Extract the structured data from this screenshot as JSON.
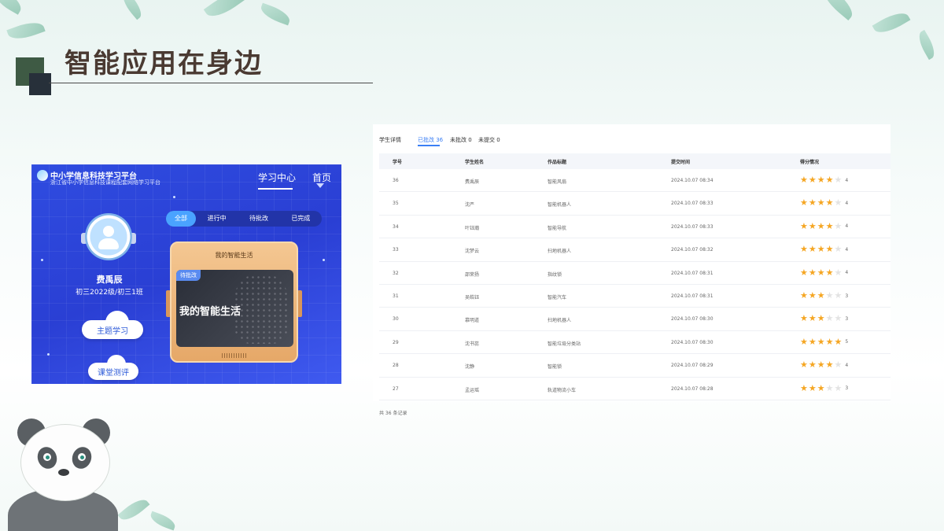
{
  "slide": {
    "title": "智能应用在身边"
  },
  "app": {
    "brand_name": "中小学信息科技学习平台",
    "brand_sub": "浙江省中小学信息科技课程配套网络学习平台",
    "nav": [
      "学习中心",
      "首页"
    ],
    "user": {
      "name": "费禹辰",
      "class": "初三2022级/初三1班"
    },
    "buttons": [
      "主题学习",
      "课堂测评"
    ],
    "tabs": [
      "全部",
      "进行中",
      "待批改",
      "已完成"
    ],
    "card": {
      "title": "我的智能生活",
      "badge": "待批改",
      "screen_text": "我的智能生活"
    }
  },
  "table": {
    "title": "学生详情",
    "tabs": [
      "已批改 36",
      "未批改 0",
      "未提交 0"
    ],
    "columns": [
      "学号",
      "学生姓名",
      "作品标题",
      "提交时间",
      "得分情况"
    ],
    "rows": [
      {
        "id": "36",
        "name": "费禹辰",
        "work": "智能风扇",
        "time": "2024.10.07 08:34",
        "score": 4
      },
      {
        "id": "35",
        "name": "沈严",
        "work": "智能机器人",
        "time": "2024.10.07 08:33",
        "score": 4
      },
      {
        "id": "34",
        "name": "叶钰瀚",
        "work": "智能导航",
        "time": "2024.10.07 08:33",
        "score": 4
      },
      {
        "id": "33",
        "name": "沈梦云",
        "work": "扫地机器人",
        "time": "2024.10.07 08:32",
        "score": 4
      },
      {
        "id": "32",
        "name": "邵荣扬",
        "work": "指纹锁",
        "time": "2024.10.07 08:31",
        "score": 4
      },
      {
        "id": "31",
        "name": "吴皓钰",
        "work": "智能汽车",
        "time": "2024.10.07 08:31",
        "score": 3
      },
      {
        "id": "30",
        "name": "慕明道",
        "work": "扫地机器人",
        "time": "2024.10.07 08:30",
        "score": 3
      },
      {
        "id": "29",
        "name": "沈书蕊",
        "work": "智能垃圾分类站",
        "time": "2024.10.07 08:30",
        "score": 5
      },
      {
        "id": "28",
        "name": "沈静",
        "work": "智能锁",
        "time": "2024.10.07 08:29",
        "score": 4
      },
      {
        "id": "27",
        "name": "孟运瑶",
        "work": "轨道物流小车",
        "time": "2024.10.07 08:28",
        "score": 3
      }
    ],
    "max_score": 5,
    "footer": "共 36 条记录"
  }
}
